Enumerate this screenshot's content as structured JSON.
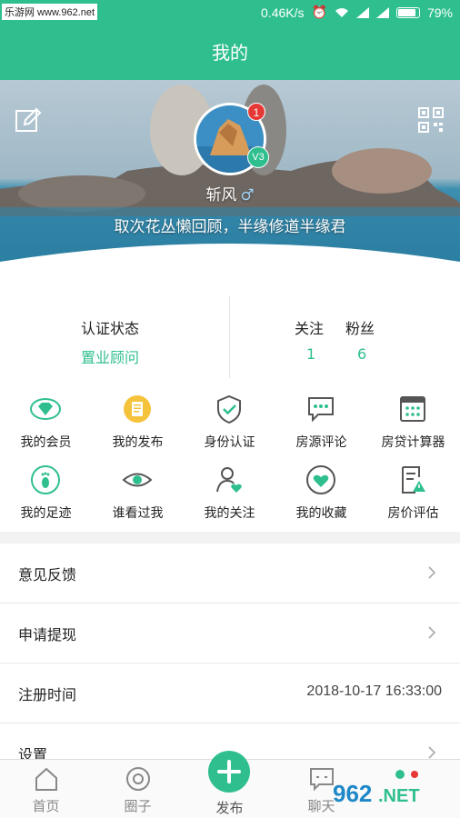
{
  "status_bar": {
    "watermark": "乐游网 www.962.net",
    "speed": "0.46K/s",
    "battery": "79%",
    "battery_level": 0.79
  },
  "header": {
    "title": "我的"
  },
  "profile": {
    "notification_count": "1",
    "level": "V3",
    "name": "斩风",
    "gender_symbol": "♂",
    "signature": "取次花丛懒回顾，半缘修道半缘君"
  },
  "stats": {
    "cert_label": "认证状态",
    "cert_value": "置业顾问",
    "follow_label": "关注",
    "follow_value": "1",
    "fans_label": "粉丝",
    "fans_value": "6"
  },
  "quick_menu": [
    {
      "label": "我的会员",
      "icon": "diamond-icon"
    },
    {
      "label": "我的发布",
      "icon": "document-icon"
    },
    {
      "label": "身份认证",
      "icon": "shield-check-icon"
    },
    {
      "label": "房源评论",
      "icon": "comment-icon"
    },
    {
      "label": "房贷计算器",
      "icon": "calculator-icon"
    },
    {
      "label": "我的足迹",
      "icon": "footprint-icon"
    },
    {
      "label": "谁看过我",
      "icon": "eye-icon"
    },
    {
      "label": "我的关注",
      "icon": "person-heart-icon"
    },
    {
      "label": "我的收藏",
      "icon": "heart-icon"
    },
    {
      "label": "房价评估",
      "icon": "report-icon"
    }
  ],
  "list": {
    "feedback": "意见反馈",
    "withdraw": "申请提现",
    "register_label": "注册时间",
    "register_value": "2018-10-17 16:33:00",
    "settings": "设置"
  },
  "tabs": {
    "home": "首页",
    "circle": "圈子",
    "publish": "发布",
    "chat": "聊天"
  },
  "colors": {
    "accent": "#2fbf8f",
    "badge": "#e53935"
  },
  "watermark_bottom": "962.NET 乐游网"
}
